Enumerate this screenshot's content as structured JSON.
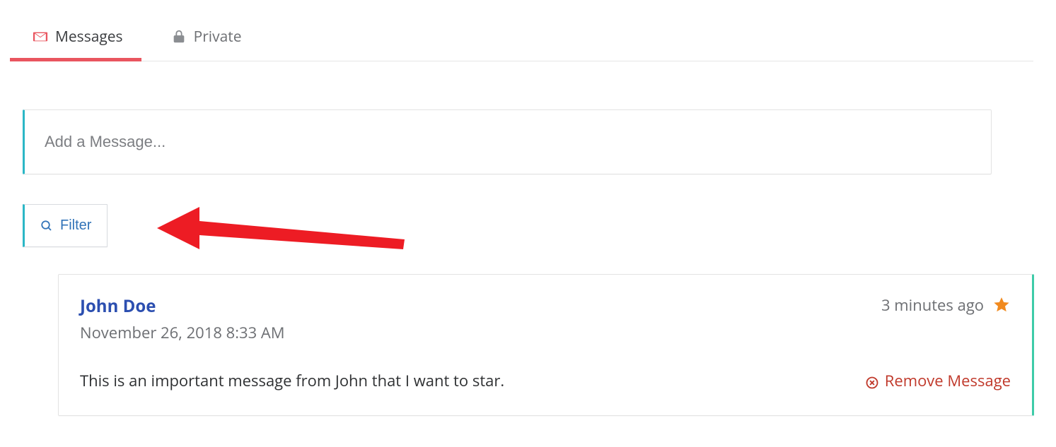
{
  "tabs": {
    "messages": "Messages",
    "private": "Private"
  },
  "composer": {
    "placeholder": "Add a Message..."
  },
  "filter": {
    "label": "Filter"
  },
  "message": {
    "author": "John Doe",
    "date": "November 26, 2018 8:33 AM",
    "time_ago": "3 minutes ago",
    "body": "This is an important message from John that I want to star.",
    "remove_label": "Remove Message"
  },
  "colors": {
    "accent_red": "#e9555f",
    "accent_teal": "#2bb7c6",
    "accent_green": "#3ecba8",
    "link_blue": "#3173b8",
    "author_blue": "#2c4fb0",
    "danger": "#c0392b",
    "star": "#f18a1f"
  }
}
